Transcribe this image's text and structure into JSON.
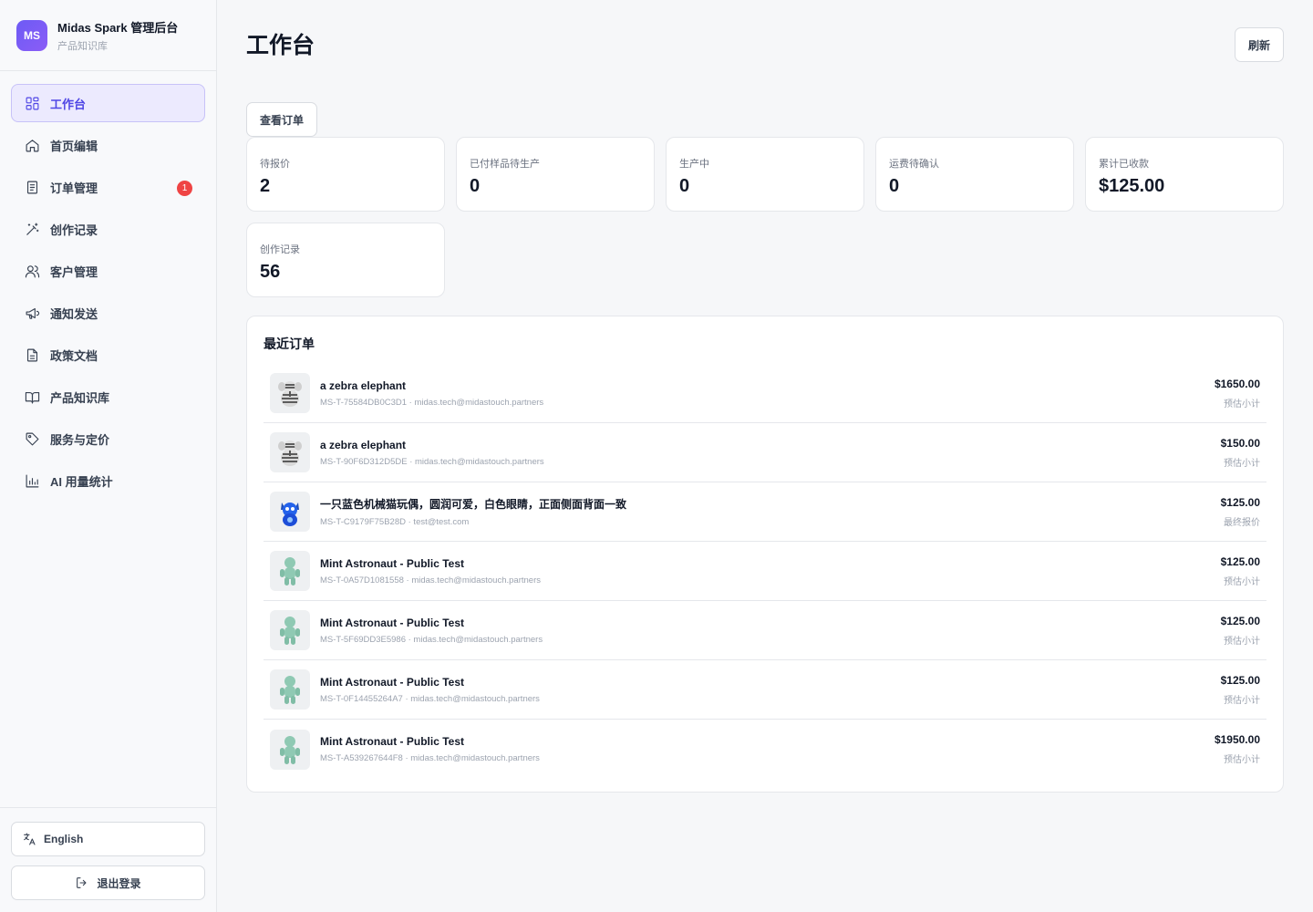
{
  "brand": {
    "logo": "MS",
    "title": "Midas Spark 管理后台",
    "subtitle": "产品知识库"
  },
  "nav": [
    {
      "label": "工作台",
      "icon": "dashboard-icon",
      "active": true
    },
    {
      "label": "首页编辑",
      "icon": "home-icon"
    },
    {
      "label": "订单管理",
      "icon": "document-icon",
      "badge": "1"
    },
    {
      "label": "创作记录",
      "icon": "magic-wand-icon"
    },
    {
      "label": "客户管理",
      "icon": "users-icon"
    },
    {
      "label": "通知发送",
      "icon": "megaphone-icon"
    },
    {
      "label": "政策文档",
      "icon": "file-text-icon"
    },
    {
      "label": "产品知识库",
      "icon": "book-icon"
    },
    {
      "label": "服务与定价",
      "icon": "tag-icon"
    },
    {
      "label": "AI 用量统计",
      "icon": "bar-chart-icon"
    }
  ],
  "footer": {
    "language": "English",
    "logout": "退出登录"
  },
  "header": {
    "title": "工作台",
    "refresh": "刷新",
    "view_orders": "查看订单"
  },
  "stats": [
    {
      "label": "待报价",
      "value": "2"
    },
    {
      "label": "已付样品待生产",
      "value": "0"
    },
    {
      "label": "生产中",
      "value": "0"
    },
    {
      "label": "运费待确认",
      "value": "0"
    },
    {
      "label": "累计已收款",
      "value": "$125.00"
    },
    {
      "label": "创作记录",
      "value": "56"
    }
  ],
  "recent": {
    "title": "最近订单",
    "orders": [
      {
        "name": "a zebra elephant",
        "meta": "MS-T-75584DB0C3D1 · midas.tech@midastouch.partners",
        "amount": "$1650.00",
        "note": "预估小计",
        "thumb": "zebra"
      },
      {
        "name": "a zebra elephant",
        "meta": "MS-T-90F6D312D5DE · midas.tech@midastouch.partners",
        "amount": "$150.00",
        "note": "预估小计",
        "thumb": "zebra"
      },
      {
        "name": "一只蓝色机械猫玩偶，圆润可爱，白色眼睛，正面侧面背面一致",
        "meta": "MS-T-C9179F75B28D · test@test.com",
        "amount": "$125.00",
        "note": "最终报价",
        "thumb": "bluecat"
      },
      {
        "name": "Mint Astronaut - Public Test",
        "meta": "MS-T-0A57D1081558 · midas.tech@midastouch.partners",
        "amount": "$125.00",
        "note": "预估小计",
        "thumb": "mint"
      },
      {
        "name": "Mint Astronaut - Public Test",
        "meta": "MS-T-5F69DD3E5986 · midas.tech@midastouch.partners",
        "amount": "$125.00",
        "note": "预估小计",
        "thumb": "mint"
      },
      {
        "name": "Mint Astronaut - Public Test",
        "meta": "MS-T-0F14455264A7 · midas.tech@midastouch.partners",
        "amount": "$125.00",
        "note": "预估小计",
        "thumb": "mint"
      },
      {
        "name": "Mint Astronaut - Public Test",
        "meta": "MS-T-A539267644F8 · midas.tech@midastouch.partners",
        "amount": "$1950.00",
        "note": "预估小计",
        "thumb": "mint"
      }
    ]
  },
  "colors": {
    "accent": "#4f46e5",
    "badge": "#ef4444",
    "background": "#f6f7f9"
  }
}
